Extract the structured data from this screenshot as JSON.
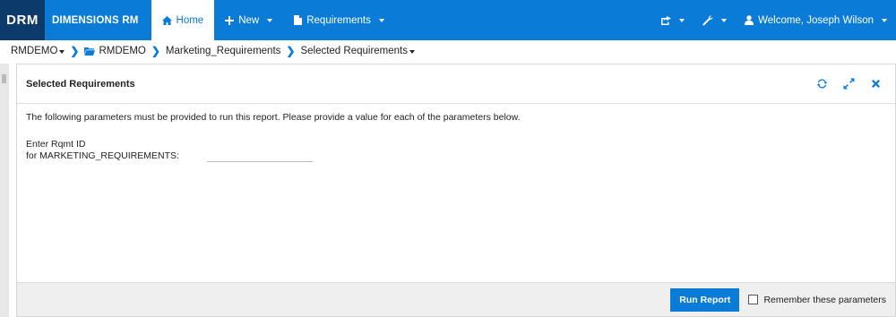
{
  "nav": {
    "logo": "DRM",
    "brand": "DIMENSIONS RM",
    "home": "Home",
    "new": "New",
    "requirements": "Requirements",
    "welcome": "Welcome, Joseph Wilson"
  },
  "breadcrumb": {
    "project": "RMDEMO",
    "folder": "RMDEMO",
    "class": "Marketing_Requirements",
    "report": "Selected Requirements"
  },
  "panel": {
    "title": "Selected Requirements",
    "intro": "The following parameters must be provided to run this report. Please provide a value for each of the parameters below.",
    "param_label_line1": "Enter Rqmt ID",
    "param_label_line2": "for MARKETING_REQUIREMENTS:",
    "param_value": "",
    "run_button": "Run Report",
    "remember_label": "Remember these parameters"
  },
  "colors": {
    "primary": "#0a7bd6",
    "logo_bg": "#0b3a6b",
    "footer_bg": "#efefef"
  },
  "icons": [
    "home-icon",
    "plus-icon",
    "document-icon",
    "share-icon",
    "wrench-icon",
    "user-icon",
    "folder-icon",
    "refresh-icon",
    "expand-icon",
    "close-icon"
  ]
}
